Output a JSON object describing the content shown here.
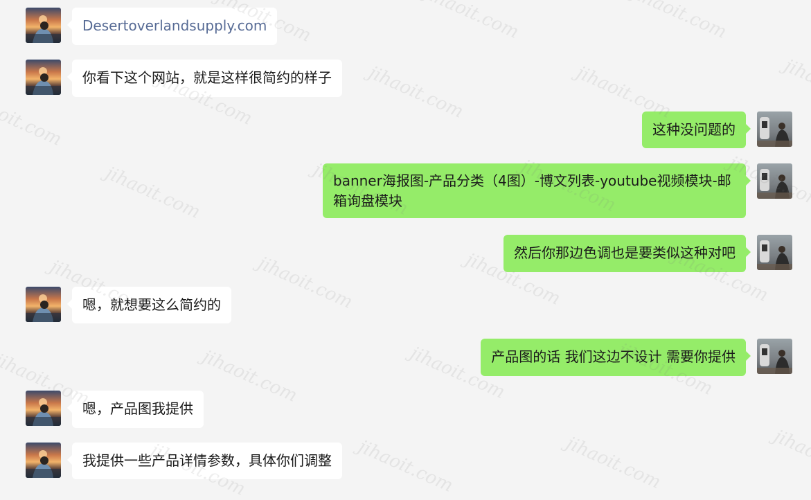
{
  "chat": {
    "messages": [
      {
        "side": "in",
        "text": "Desertoverlandsupply.com",
        "is_link": true
      },
      {
        "side": "in",
        "text": "你看下这个网站，就是这样很简约的样子"
      },
      {
        "side": "out",
        "text": "这种没问题的"
      },
      {
        "side": "out",
        "text": "banner海报图-产品分类（4图）-博文列表-youtube视频模块-邮箱询盘模块"
      },
      {
        "side": "out",
        "text": "然后你那边色调也是要类似这种对吧"
      },
      {
        "side": "in",
        "text": "嗯，就想要这么简约的"
      },
      {
        "side": "out",
        "text": "产品图的话 我们这边不设计 需要你提供"
      },
      {
        "side": "in",
        "text": "嗯，产品图我提供"
      },
      {
        "side": "in",
        "text": "我提供一些产品详情参数，具体你们调整"
      }
    ]
  },
  "watermark": {
    "text": "jihaoit.com"
  },
  "colors": {
    "background": "#f4f4f4",
    "incoming_bubble": "#ffffff",
    "outgoing_bubble": "#95ec69",
    "link": "#576b95"
  }
}
